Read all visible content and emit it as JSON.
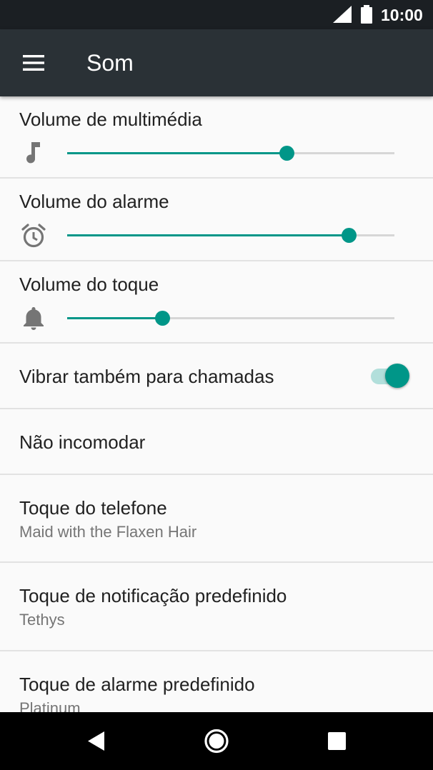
{
  "status_bar": {
    "time": "10:00",
    "icons": [
      "signal-icon",
      "battery-icon"
    ]
  },
  "toolbar": {
    "menu_icon": "menu-icon",
    "title": "Som"
  },
  "volumes": [
    {
      "label": "Volume de multimédia",
      "icon": "music-note-icon",
      "level": 0.67
    },
    {
      "label": "Volume do alarme",
      "icon": "alarm-clock-icon",
      "level": 0.86
    },
    {
      "label": "Volume do toque",
      "icon": "bell-icon",
      "level": 0.29
    }
  ],
  "vibrate": {
    "label": "Vibrar também para chamadas",
    "enabled": true
  },
  "settings": [
    {
      "label": "Não incomodar"
    },
    {
      "label": "Toque do telefone",
      "value": "Maid with the Flaxen Hair"
    },
    {
      "label": "Toque de notificação predefinido",
      "value": "Tethys"
    },
    {
      "label": "Toque de alarme predefinido",
      "value": "Platinum"
    }
  ],
  "nav_bar": {
    "icons": [
      "back-icon",
      "home-icon",
      "recents-icon"
    ]
  },
  "colors": {
    "accent": "#009688",
    "toolbar": "#2a3136",
    "status_bar": "#1b1f23",
    "background": "#fafafa"
  }
}
